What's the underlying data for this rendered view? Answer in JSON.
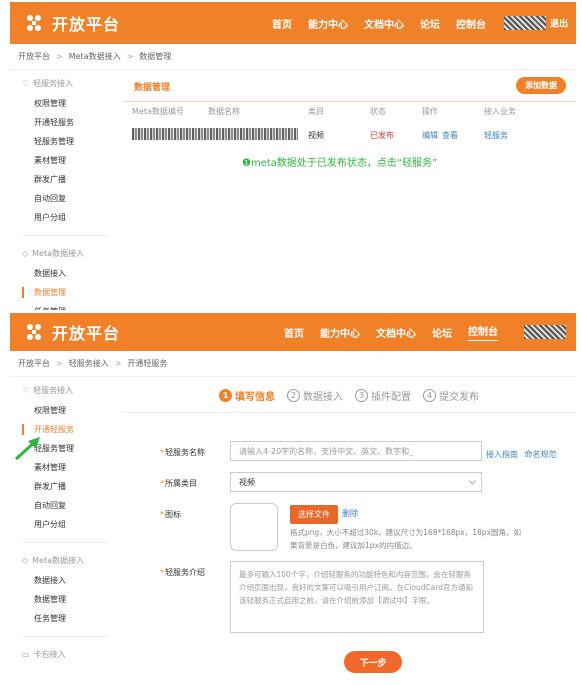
{
  "brand": {
    "name": "开放平台",
    "accent": "#f08128",
    "annotation_color": "#2eb53d"
  },
  "screen1": {
    "nav": [
      "首页",
      "能力中心",
      "文档中心",
      "论坛",
      "控制台"
    ],
    "logout": "退出",
    "breadcrumb": [
      "开放平台",
      "Meta数据接入",
      "数据管理"
    ],
    "sidebar": {
      "group1": "轻服务接入",
      "group1_items": [
        "权限管理",
        "开通轻服务",
        "轻服务管理",
        "素材管理",
        "群发广播",
        "自动回复",
        "用户分组"
      ],
      "group2": "Meta数据接入",
      "group2_items": [
        "数据接入",
        "数据管理",
        "任务管理"
      ],
      "active": "数据管理"
    },
    "section_title": "数据管理",
    "add_button": "添加数据",
    "table": {
      "headers": [
        "Meta数据编号",
        "数据名称",
        "类目",
        "状态",
        "操作",
        "接入业务"
      ],
      "row": {
        "category": "视频",
        "status": "已发布",
        "edit": "编辑",
        "view": "查看",
        "service": "轻服务"
      }
    },
    "annotation": "❶meta数据处于已发布状态，点击“轻服务”"
  },
  "screen2": {
    "nav": [
      "首页",
      "能力中心",
      "文档中心",
      "论坛",
      "控制台"
    ],
    "breadcrumb": [
      "开放平台",
      "轻服务接入",
      "开通轻服务"
    ],
    "sidebar": {
      "group1": "轻服务接入",
      "group1_items": [
        "权限管理",
        "开通轻服务",
        "轻服务管理",
        "素材管理",
        "群发广播",
        "自动回复",
        "用户分组"
      ],
      "group2": "Meta数据接入",
      "group2_items": [
        "数据接入",
        "数据管理",
        "任务管理"
      ],
      "group3": "卡包接入",
      "active": "开通轻服务"
    },
    "steps": [
      {
        "num": "1",
        "label": "填写信息"
      },
      {
        "num": "2",
        "label": "数据接入"
      },
      {
        "num": "3",
        "label": "插件配置"
      },
      {
        "num": "4",
        "label": "提交发布"
      }
    ],
    "form": {
      "name_label": "轻服务名称",
      "name_placeholder": "请输入4-20字的名称，支持中文、英文、数字和_",
      "link_guide": "接入指南",
      "link_rules": "命名规范",
      "category_label": "所属类目",
      "category_value": "视频",
      "icon_label": "图标",
      "upload_button": "选择文件",
      "delete_link": "删除",
      "icon_hint": "格式png，大小不超过30k，建议尺寸为168*168px，18px圆角。如果背景是白色，建议加1px的内描边。",
      "intro_label": "轻服务介绍",
      "intro_placeholder": "最多可输入100个字，介绍轻服务的功能特色和内容范围，会在轻服务介绍页面出现，良好的文案可以吸引用户订阅。在CloudCard官方通知该轻服务正式启用之前，请在介绍前添加【调试中】字眼。",
      "next_button": "下一步"
    }
  }
}
